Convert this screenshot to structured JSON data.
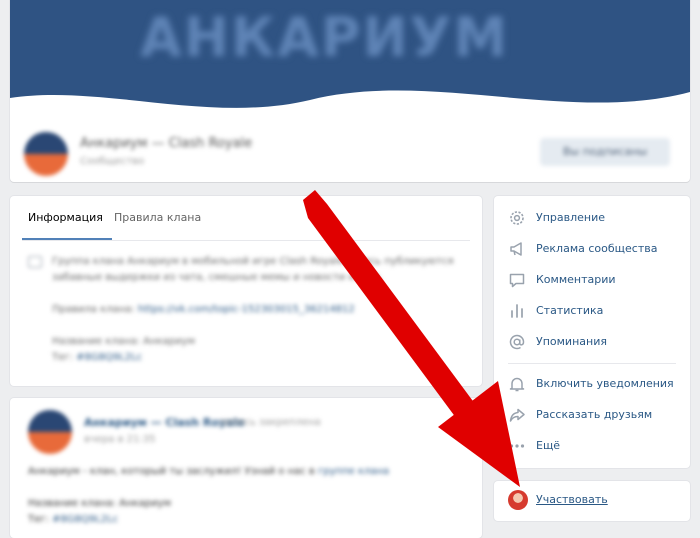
{
  "cover": {
    "title": "АНКАРИУМ"
  },
  "group": {
    "name": "Анкариум — Clash Royale",
    "subtitle": "Сообщество",
    "subscribe_label": "Вы подписаны"
  },
  "tabs": [
    {
      "label": "Информация",
      "active": true
    },
    {
      "label": "Правила клана",
      "active": false
    }
  ],
  "info": {
    "description": "Группа клана Анкариум в мобильной игре Clash Royale. Здесь публикуются забавные выдержки из чата, смешные мемы и новости клана.",
    "rules_label": "Правила клана:",
    "rules_link": "https://vk.com/topic-152303015_36214812",
    "clan_name_label": "Название клана: Анкариум",
    "tag_label": "Тег:",
    "tag_value": "#8G8Q9L2Lc"
  },
  "post": {
    "author": "Анкариум — Clash Royale",
    "meta": "запись закреплена",
    "date": "вчера в 21:35",
    "text_line1": "Анкариум - клан, который ты заслужил! Узнай о нас в",
    "text_link": "группе клана",
    "text_line2": "Название клана: Анкариум",
    "tag_label": "Тег:",
    "tag_value": "#8G8Q9L2Lc"
  },
  "menu": {
    "items": [
      {
        "label": "Управление",
        "icon": "gear-icon"
      },
      {
        "label": "Реклама сообщества",
        "icon": "megaphone-icon"
      },
      {
        "label": "Комментарии",
        "icon": "comment-icon"
      },
      {
        "label": "Статистика",
        "icon": "stats-icon"
      },
      {
        "label": "Упоминания",
        "icon": "at-icon"
      },
      {
        "label": "Включить уведомления",
        "icon": "bell-icon"
      },
      {
        "label": "Рассказать друзьям",
        "icon": "share-icon"
      },
      {
        "label": "Ещё",
        "icon": "more-icon"
      }
    ]
  },
  "join": {
    "label": "Участвовать"
  },
  "colors": {
    "accent": "#2a5885",
    "arrow": "#e00000",
    "cover": "#2b4d7d"
  }
}
